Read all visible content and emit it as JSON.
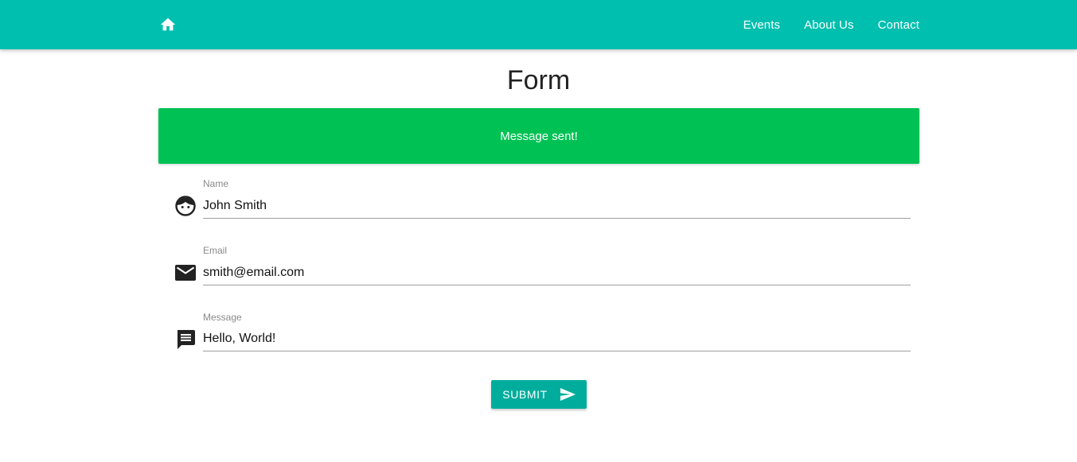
{
  "navbar": {
    "home_icon": "home-icon",
    "links": [
      "Events",
      "About Us",
      "Contact"
    ]
  },
  "page": {
    "title": "Form"
  },
  "alert": {
    "message": "Message sent!",
    "color": "#00c254"
  },
  "form": {
    "name": {
      "label": "Name",
      "value": "John Smith",
      "icon": "face-icon"
    },
    "email": {
      "label": "Email",
      "value": "smith@email.com",
      "icon": "mail-icon"
    },
    "message": {
      "label": "Message",
      "value": "Hello, World!",
      "icon": "message-icon"
    },
    "submit": {
      "label": "SUBMIT",
      "icon": "send-icon"
    }
  },
  "colors": {
    "navbar": "#00bfae",
    "button": "#00ad9c",
    "alert": "#00c254"
  }
}
